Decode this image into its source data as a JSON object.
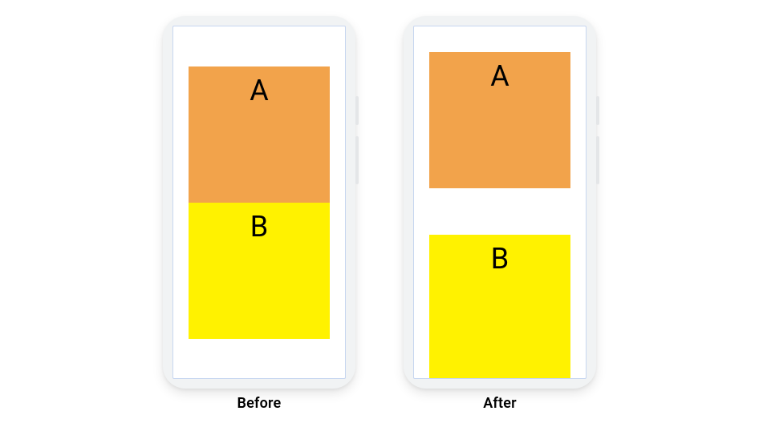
{
  "diagram": {
    "before": {
      "caption": "Before",
      "blockA": "A",
      "blockB": "B"
    },
    "after": {
      "caption": "After",
      "blockA": "A",
      "blockB": "B"
    }
  },
  "colors": {
    "blockA": "#f2a34b",
    "blockB": "#fff200",
    "phoneBody": "#f1f3f4",
    "screenBorder": "#c7d6f0"
  }
}
